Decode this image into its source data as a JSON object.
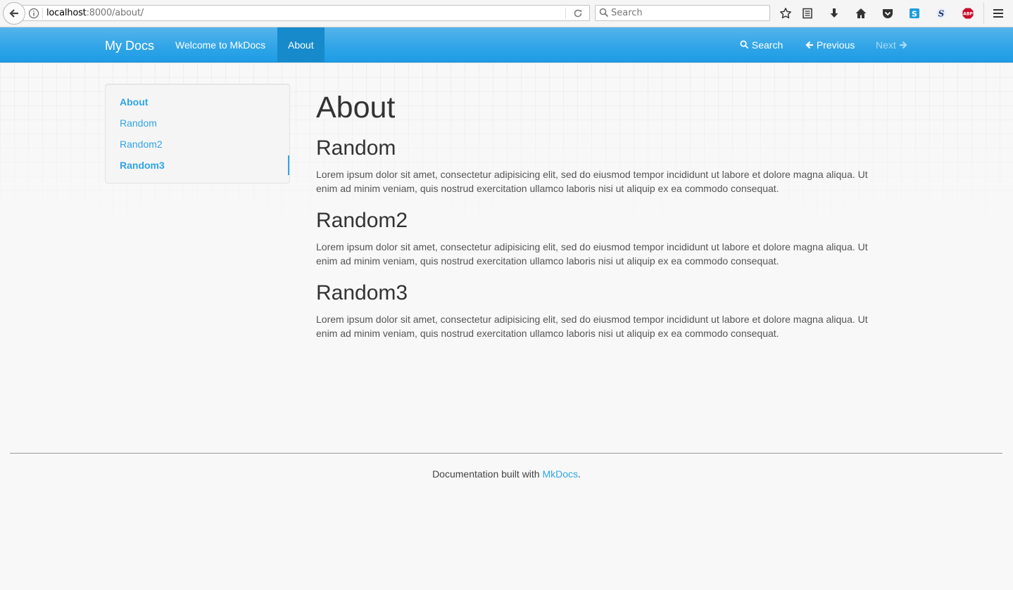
{
  "browser": {
    "url_host": "localhost",
    "url_rest": ":8000/about/",
    "search_placeholder": "Search"
  },
  "navbar": {
    "brand": "My Docs",
    "links": [
      {
        "label": "Welcome to MkDocs",
        "active": false
      },
      {
        "label": "About",
        "active": true
      }
    ],
    "search_label": "Search",
    "previous_label": "Previous",
    "next_label": "Next"
  },
  "sidebar": {
    "items": [
      {
        "label": "About"
      },
      {
        "label": "Random"
      },
      {
        "label": "Random2"
      },
      {
        "label": "Random3"
      }
    ]
  },
  "main": {
    "title": "About",
    "sections": [
      {
        "heading": "Random",
        "body": "Lorem ipsum dolor sit amet, consectetur adipisicing elit, sed do eiusmod tempor incididunt ut labore et dolore magna aliqua. Ut enim ad minim veniam, quis nostrud exercitation ullamco laboris nisi ut aliquip ex ea commodo consequat."
      },
      {
        "heading": "Random2",
        "body": "Lorem ipsum dolor sit amet, consectetur adipisicing elit, sed do eiusmod tempor incididunt ut labore et dolore magna aliqua. Ut enim ad minim veniam, quis nostrud exercitation ullamco laboris nisi ut aliquip ex ea commodo consequat."
      },
      {
        "heading": "Random3",
        "body": "Lorem ipsum dolor sit amet, consectetur adipisicing elit, sed do eiusmod tempor incididunt ut labore et dolore magna aliqua. Ut enim ad minim veniam, quis nostrud exercitation ullamco laboris nisi ut aliquip ex ea commodo consequat."
      }
    ]
  },
  "footer": {
    "text_before": "Documentation built with ",
    "link_label": "MkDocs",
    "text_after": "."
  },
  "colors": {
    "accent": "#2fa4e7",
    "navbar_active": "#178acc",
    "page_background": "#f8f8f8"
  },
  "icons": [
    "back-arrow-icon",
    "info-icon",
    "reload-icon",
    "search-icon",
    "bookmark-star-icon",
    "reading-list-icon",
    "download-icon",
    "home-icon",
    "pocket-icon",
    "skype-icon",
    "extension-s-icon",
    "adblock-icon",
    "menu-icon",
    "arrow-left-icon",
    "arrow-right-icon"
  ]
}
